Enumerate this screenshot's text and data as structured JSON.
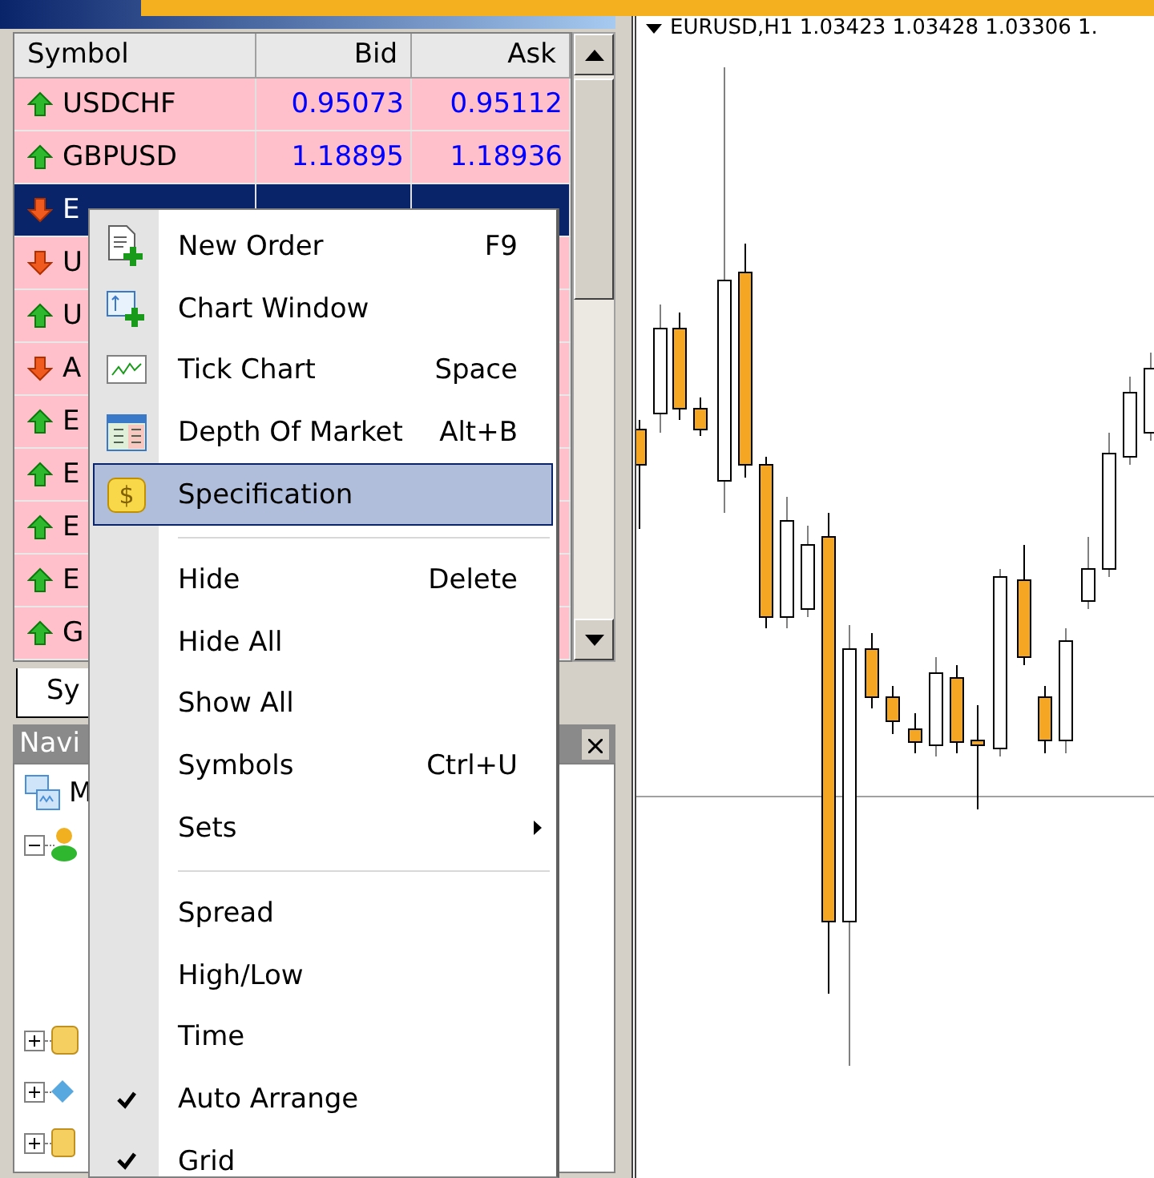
{
  "market_watch": {
    "columns": [
      "Symbol",
      "Bid",
      "Ask"
    ],
    "rows": [
      {
        "symbol": "USDCHF",
        "bid": "0.95073",
        "ask": "0.95112",
        "rising": true,
        "selected": false
      },
      {
        "symbol": "GBPUSD",
        "bid": "1.18895",
        "ask": "1.18936",
        "rising": true,
        "selected": false
      },
      {
        "symbol": "E",
        "rising": false,
        "selected": true
      },
      {
        "symbol": "U",
        "rising": false,
        "selected": false
      },
      {
        "symbol": "U",
        "rising": true,
        "selected": false
      },
      {
        "symbol": "A",
        "rising": false,
        "selected": false
      },
      {
        "symbol": "E",
        "rising": true,
        "selected": false
      },
      {
        "symbol": "E",
        "rising": true,
        "selected": false
      },
      {
        "symbol": "E",
        "rising": true,
        "selected": false
      },
      {
        "symbol": "E",
        "rising": true,
        "selected": false
      },
      {
        "symbol": "G",
        "rising": true,
        "selected": false
      }
    ],
    "tabs": [
      {
        "label": "Sy",
        "selected": true
      }
    ]
  },
  "navigator": {
    "title": "Navi",
    "tree": [
      {
        "label": "M",
        "children": [
          {
            "expanded": true
          },
          {
            "expanded": false
          },
          {
            "expanded": false
          },
          {
            "expanded": false
          }
        ]
      }
    ]
  },
  "chart": {
    "header": "EURUSD,H1  1.03423 1.03428 1.03306 1."
  },
  "context_menu": {
    "groups": [
      [
        {
          "label": "New Order",
          "shortcut": "F9",
          "checked": false,
          "submenu": false,
          "selected": false
        },
        {
          "label": "Chart Window",
          "checked": false,
          "submenu": false,
          "selected": false
        },
        {
          "label": "Tick Chart",
          "shortcut": "Space",
          "checked": false,
          "submenu": false,
          "selected": false
        },
        {
          "label": "Depth Of Market",
          "shortcut": "Alt+B",
          "checked": false,
          "submenu": false,
          "selected": false
        },
        {
          "label": "Specification",
          "icon_glyph": "$",
          "checked": false,
          "submenu": false,
          "selected": true
        }
      ],
      [
        {
          "label": "Hide",
          "shortcut": "Delete",
          "checked": false,
          "submenu": false,
          "selected": false
        },
        {
          "label": "Hide All",
          "checked": false,
          "submenu": false,
          "selected": false
        },
        {
          "label": "Show All",
          "checked": false,
          "submenu": false,
          "selected": false
        },
        {
          "label": "Symbols",
          "shortcut": "Ctrl+U",
          "checked": false,
          "submenu": false,
          "selected": false
        },
        {
          "label": "Sets",
          "checked": false,
          "submenu": true,
          "selected": false
        }
      ],
      [
        {
          "label": "Spread",
          "checked": false,
          "submenu": false,
          "selected": false
        },
        {
          "label": "High/Low",
          "checked": false,
          "submenu": false,
          "selected": false
        },
        {
          "label": "Time",
          "checked": false,
          "submenu": false,
          "selected": false
        },
        {
          "label": "Auto Arrange",
          "checked": true,
          "submenu": false,
          "selected": false
        },
        {
          "label": "Grid",
          "checked": true,
          "submenu": false,
          "selected": false
        }
      ]
    ]
  }
}
